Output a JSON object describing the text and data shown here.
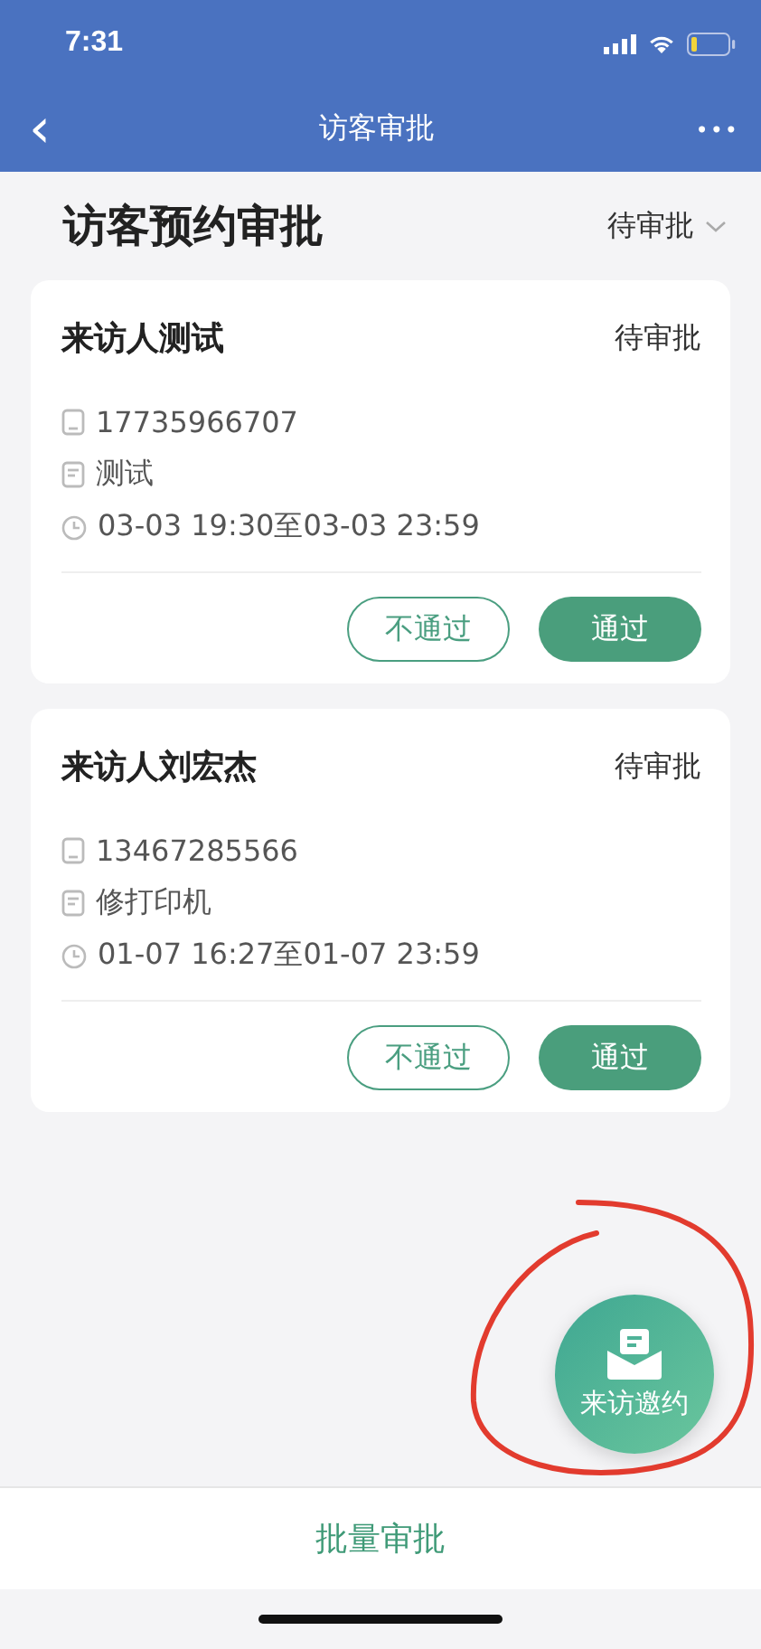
{
  "status_bar": {
    "time": "7:31"
  },
  "nav": {
    "back": "‹",
    "title": "访客审批",
    "more": "•••"
  },
  "header": {
    "title": "访客预约审批",
    "filter": "待审批"
  },
  "requests": [
    {
      "name": "来访人测试",
      "status": "待审批",
      "phone": "17735966707",
      "reason": "测试",
      "time": "03-03 19:30至03-03 23:59",
      "reject": "不通过",
      "approve": "通过"
    },
    {
      "name": "来访人刘宏杰",
      "status": "待审批",
      "phone": "13467285566",
      "reason": "修打印机",
      "time": "01-07 16:27至01-07 23:59",
      "reject": "不通过",
      "approve": "通过"
    }
  ],
  "fab": {
    "label": "来访邀约"
  },
  "bottom_bar": {
    "label": "批量审批"
  }
}
